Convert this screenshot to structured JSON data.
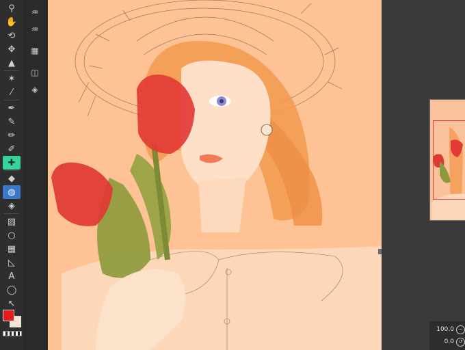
{
  "toolbar": {
    "tools": [
      {
        "name": "zoom-tool",
        "icon": "magnifier-icon",
        "glyph": "⚲"
      },
      {
        "name": "hand-tool",
        "icon": "hand-icon",
        "glyph": "✋"
      },
      {
        "name": "rotate-tool",
        "icon": "rotate-icon",
        "glyph": "⟲"
      },
      {
        "name": "move-tool",
        "icon": "move-icon",
        "glyph": "✥"
      },
      {
        "name": "object-tool",
        "icon": "object-icon",
        "glyph": "▲"
      },
      {
        "name": "auto-select-tool",
        "icon": "magic-wand-icon",
        "glyph": "✶"
      },
      {
        "name": "eyedropper-tool",
        "icon": "eyedropper-icon",
        "glyph": "⁄"
      },
      {
        "name": "pen-tool",
        "icon": "pen-icon",
        "glyph": "✒"
      },
      {
        "name": "pencil-tool",
        "icon": "pencil-icon",
        "glyph": "✎"
      },
      {
        "name": "brush-tool",
        "icon": "brush-icon",
        "glyph": "✏"
      },
      {
        "name": "airbrush-tool",
        "icon": "airbrush-icon",
        "glyph": "✐"
      },
      {
        "name": "decoration-tool",
        "icon": "decoration-icon",
        "glyph": "✚"
      },
      {
        "name": "eraser-tool",
        "icon": "eraser-icon",
        "glyph": "◆"
      },
      {
        "name": "blend-tool",
        "icon": "blend-icon",
        "glyph": "◍"
      },
      {
        "name": "fill-tool",
        "icon": "fill-bucket-icon",
        "glyph": "◈"
      },
      {
        "name": "gradient-tool",
        "icon": "gradient-icon",
        "glyph": "▨"
      },
      {
        "name": "figure-tool",
        "icon": "circle-icon",
        "glyph": "○"
      },
      {
        "name": "frame-tool",
        "icon": "frame-icon",
        "glyph": "▦"
      },
      {
        "name": "ruler-tool",
        "icon": "ruler-icon",
        "glyph": "◺"
      },
      {
        "name": "text-tool",
        "icon": "text-icon",
        "glyph": "A"
      },
      {
        "name": "balloon-tool",
        "icon": "speech-balloon-icon",
        "glyph": "◯"
      },
      {
        "name": "correct-line-tool",
        "icon": "correct-line-icon",
        "glyph": "↖"
      }
    ],
    "active_tool": "decoration-tool",
    "colors": {
      "main": "#e31b1b",
      "sub": "#f7e3d2"
    }
  },
  "sub_toolbar": {
    "items": [
      {
        "name": "sub-tool-airbrush-soft",
        "icon": "airbrush-drops-icon",
        "glyph": "♒"
      },
      {
        "name": "sub-tool-airbrush-spray",
        "icon": "airbrush-spray-icon",
        "glyph": "♒"
      },
      {
        "name": "sub-tool-layer-grid",
        "icon": "layer-grid-icon",
        "glyph": "▦"
      },
      {
        "name": "sub-tool-layer-settings",
        "icon": "layer-settings-icon",
        "glyph": "◫"
      },
      {
        "name": "sub-tool-layers",
        "icon": "layers-icon",
        "glyph": "◈"
      }
    ]
  },
  "status": {
    "zoom_value": "100.0",
    "rotation_value": "0.0"
  },
  "theme": {
    "canvas_bg": "#ffc294",
    "panel_bg": "#3a3a3a",
    "toolbar_bg": "#2e2e2e",
    "accent_green": "#36d39b",
    "accent_blue": "#3a78c8",
    "navigator_frame": "#e03a3a"
  }
}
